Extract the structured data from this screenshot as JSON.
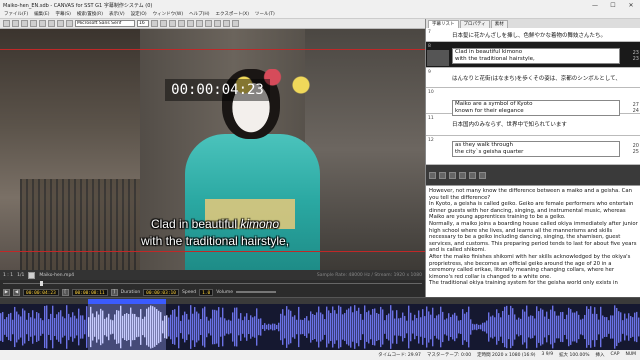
{
  "window": {
    "title": "Maiko-hen_EN.sdb - CANVAS for SST G1 字幕制作システム (0)",
    "min": "—",
    "max": "☐",
    "close": "✕"
  },
  "menu": [
    "ファイル(F)",
    "編集(E)",
    "字幕(S)",
    "検索/置換(R)",
    "表示(V)",
    "設定(O)",
    "ウィンドウ(W)",
    "ヘルプ(H)",
    "エクスポート(X)",
    "ツール(T)"
  ],
  "toolbar": {
    "font": "Microsoft Sans Serif",
    "size": "16"
  },
  "video": {
    "timecode": "00:00:04:23",
    "subtitle_line1": "Clad in beautiful ",
    "subtitle_italic": "kimono",
    "subtitle_line2": "with the traditional hairstyle,"
  },
  "video_status": {
    "zoom": "1 : 1",
    "page": "1/1",
    "file": "Maiko-hen.mp4",
    "info": "Sample Rate: 48000 Hz / Stream: 1920 x 1080"
  },
  "timecodes": {
    "in": "00:00:04:23",
    "out": "00:00:08:11",
    "duration_label": "Duration",
    "duration": "00:00:03:10",
    "speed_label": "Speed",
    "speed": "1.0",
    "volume_label": "Volume"
  },
  "right_tabs": [
    "字幕リスト",
    "プロパティ",
    "素材"
  ],
  "subtitles": [
    {
      "num": "7",
      "jp": "日本髪に花かんざしを挿し、色鮮やかな着物の舞妓さんたち。"
    },
    {
      "num": "8",
      "en": "Clad in beautiful kimono",
      "en2": "with the traditional hairstyle,",
      "idx1": "23",
      "idx2": "23"
    },
    {
      "num": "9",
      "jp": "はんなりと花街(はなまち)を歩くその姿は、京都のシンボルとして、"
    },
    {
      "num": "10",
      "en": "Maiko are a symbol of Kyoto",
      "en2": "known for their elegance",
      "idx1": "27",
      "idx2": "24"
    },
    {
      "num": "11",
      "jp": "日本国内のみならず、世界中で知られています"
    },
    {
      "num": "12",
      "en": "as they walk through",
      "en2": "the city`s geisha quarter",
      "idx1": "20",
      "idx2": "25"
    }
  ],
  "notes": [
    "However, not many know the difference between a maiko and a geisha. Can you tell the difference?",
    "In Kyoto, a geisha is called geiko. Geiko are female performers who entertain dinner guests with her dancing, singing, and instrumental music, whereas Maiko are young apprentices training to be a geiko.",
    "Normally, a maiko joins a boarding house called okiya immediately after junior high school where she lives, and learns all the mannerisms and skills necessary to be a geiko including dancing, singing, the shamisen, guest services, and customs. This preparing period tends to last for about five years and is called shikomi.",
    "After the maiko finishes shikomi with her skills acknowledged by the okiya's proprietress, she becomes an official geiko around the age of 20 in a ceremony called erikae, literally meaning changing collars, where her kimono's red collar is changed to a white one.",
    "The traditional okiya training system for the geisha world only exists in"
  ],
  "statusbar": {
    "left": "",
    "right": [
      "タイムコード: 29.97",
      "マスターテープ: 0:00",
      "定時間 2020 x 1080 (16:9)",
      "3 9/9",
      "拡大 100.00%",
      "挿入",
      "CAP",
      "NUM"
    ]
  },
  "colors": {
    "accent": "#3b5bff",
    "timecode_fg": "#ffd23a",
    "waveform": "#6b72e6",
    "highlight": "#a0aaff"
  }
}
